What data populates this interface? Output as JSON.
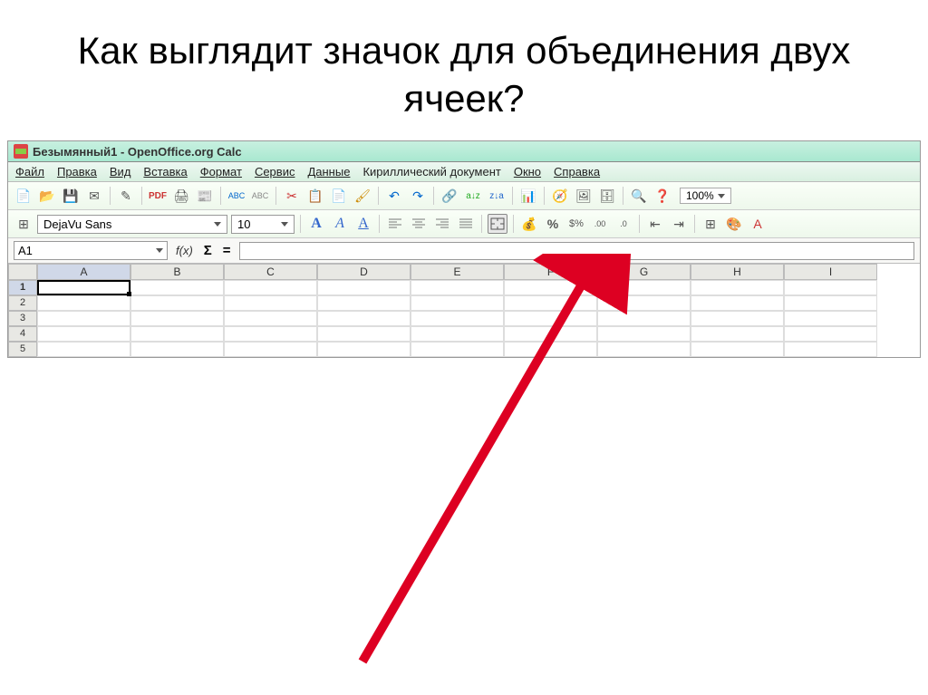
{
  "slide": {
    "title": "Как выглядит значок для объединения двух ячеек?"
  },
  "titlebar": {
    "doc_name": "Безымянный1 - OpenOffice.org Calc"
  },
  "menus": [
    "Файл",
    "Правка",
    "Вид",
    "Вставка",
    "Формат",
    "Сервис",
    "Данные",
    "Кириллический документ",
    "Окно",
    "Справка"
  ],
  "toolbar": {
    "icons": [
      "new-doc-icon",
      "open-icon",
      "save-icon",
      "email-icon",
      "edit-icon",
      "pdf-icon",
      "print-icon",
      "preview-icon",
      "spellcheck-on-icon",
      "spellcheck-off-icon",
      "cut-icon",
      "copy-icon",
      "paste-icon",
      "format-paint-icon",
      "undo-icon",
      "redo-icon",
      "hyperlink-icon",
      "sort-asc-icon",
      "sort-desc-icon",
      "chart-icon",
      "navigator-icon",
      "gallery-icon",
      "datasource-icon",
      "zoom-icon",
      "help-icon"
    ],
    "zoom": "100%"
  },
  "fmt": {
    "font_name": "DejaVu Sans",
    "font_size": "10",
    "icons_left": [
      "style-icon"
    ],
    "text_icons": [
      "bold-icon",
      "italic-icon",
      "underline-icon"
    ],
    "align_icons": [
      "align-left-icon",
      "align-center-icon",
      "align-right-icon",
      "justify-icon"
    ],
    "merge_icon": "merge-cells-icon",
    "num_icons": [
      "currency-icon",
      "percent-icon",
      "money-icon",
      "add-decimal-icon",
      "remove-decimal-icon"
    ],
    "indent_icons": [
      "decrease-indent-icon",
      "increase-indent-icon"
    ],
    "border_icons": [
      "border-icon",
      "bgcolor-icon",
      "fontcolor-icon"
    ]
  },
  "formulabar": {
    "cell_ref": "A1",
    "fx": "f(x)",
    "sigma": "Σ",
    "eq": "=",
    "formula": ""
  },
  "grid": {
    "col_headers": [
      "A",
      "B",
      "C",
      "D",
      "E",
      "F",
      "G",
      "H",
      "I"
    ],
    "row_headers": [
      "1",
      "2",
      "3",
      "4",
      "5"
    ],
    "active": {
      "row": 0,
      "col": 0
    }
  }
}
